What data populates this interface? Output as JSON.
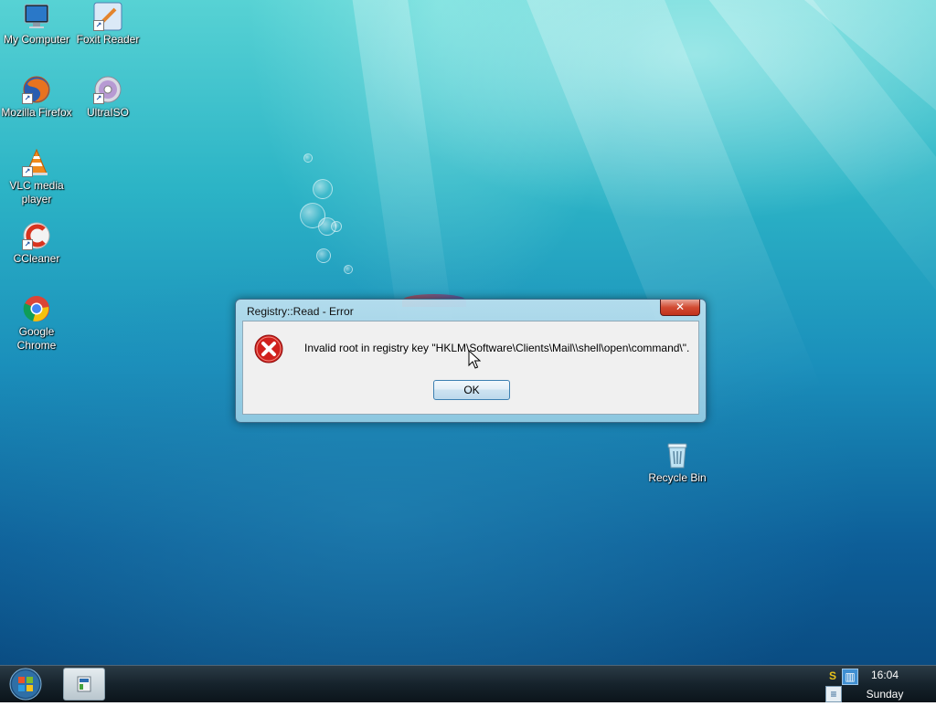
{
  "desktop": {
    "icons": [
      {
        "name": "my-computer-icon",
        "label": "My Computer"
      },
      {
        "name": "foxit-reader-icon",
        "label": "Foxit Reader"
      },
      {
        "name": "mozilla-firefox-icon",
        "label": "Mozilla Firefox"
      },
      {
        "name": "ultraiso-icon",
        "label": "UltraISO"
      },
      {
        "name": "vlc-media-player-icon",
        "label": "VLC media player"
      },
      {
        "name": "ccleaner-icon",
        "label": "CCleaner"
      },
      {
        "name": "google-chrome-icon",
        "label": "Google Chrome"
      },
      {
        "name": "recycle-bin-icon",
        "label": "Recycle Bin"
      }
    ]
  },
  "dialog": {
    "title": "Registry::Read - Error",
    "close_glyph": "✕",
    "message": "Invalid root in registry key \"HKLM\\Software\\Clients\\Mail\\\\shell\\open\\command\\\".",
    "ok_label": "OK",
    "icon": "error-icon"
  },
  "taskbar": {
    "start_icon": "windows-orb-icon",
    "clock_time": "16:04",
    "clock_day": "Sunday"
  },
  "colors": {
    "error_red": "#d0201c",
    "close_red": "#c0321b",
    "ok_border": "#3c7fb1"
  }
}
